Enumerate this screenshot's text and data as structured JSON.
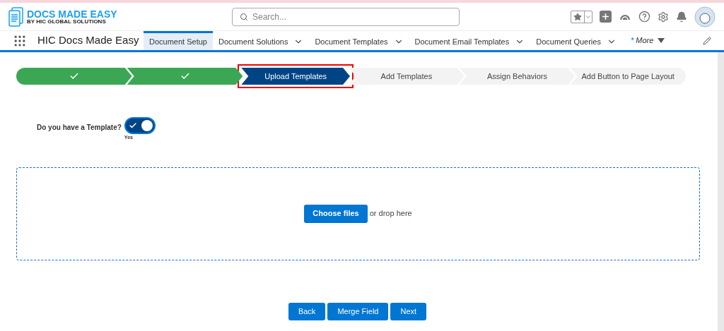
{
  "header": {
    "logo": {
      "title": "DOCS MADE EASY",
      "subtitle": "BY HIC GLOBAL SOLUTIONS"
    },
    "search": {
      "placeholder": "Search..."
    }
  },
  "nav": {
    "app_name": "HIC Docs Made Easy",
    "tabs": [
      {
        "label": "Document Setup",
        "selected": true,
        "dropdown": false
      },
      {
        "label": "Document Solutions",
        "selected": false,
        "dropdown": true
      },
      {
        "label": "Document Templates",
        "selected": false,
        "dropdown": true
      },
      {
        "label": "Document Email Templates",
        "selected": false,
        "dropdown": true
      },
      {
        "label": "Document Queries",
        "selected": false,
        "dropdown": true
      }
    ],
    "more": {
      "marker": "*",
      "label": "More"
    }
  },
  "path": [
    {
      "kind": "complete",
      "highlighted": false
    },
    {
      "kind": "complete",
      "highlighted": false
    },
    {
      "label": "Upload Templates",
      "kind": "current",
      "highlighted": true
    },
    {
      "label": "Add Templates",
      "kind": "pending",
      "highlighted": false
    },
    {
      "label": "Assign Behaviors",
      "kind": "pending",
      "highlighted": false
    },
    {
      "label": "Add Button to Page Layout",
      "kind": "pending",
      "highlighted": false
    }
  ],
  "template_toggle": {
    "label": "Do you have a Template?",
    "on": true,
    "state_label": "Yes"
  },
  "upload": {
    "button": "Choose files",
    "hint": "or drop here"
  },
  "buttons": [
    "Back",
    "Merge Field",
    "Next"
  ]
}
